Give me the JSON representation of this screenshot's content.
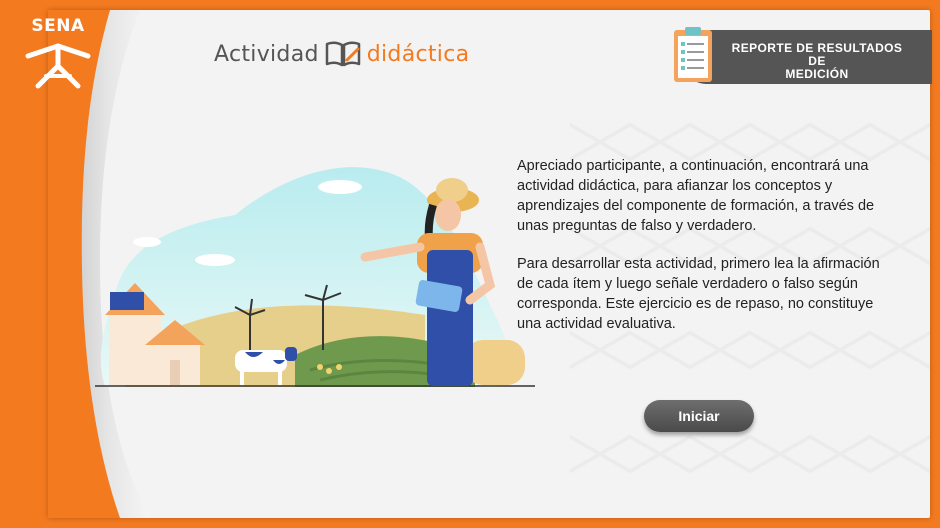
{
  "brand": {
    "logo_text": "SENA"
  },
  "header": {
    "title_part1": "Actividad",
    "title_part2": "didáctica",
    "report_label_line1": "REPORTE DE RESULTADOS DE",
    "report_label_line2": "MEDICIÓN"
  },
  "main": {
    "paragraph1": "Apreciado participante, a continuación, encontrará una actividad didáctica, para afianzar los conceptos y aprendizajes del componente de formación, a través de unas preguntas de falso y verdadero.",
    "paragraph2": "Para desarrollar esta actividad, primero lea la afirmación de cada ítem y luego señale verdadero o falso según corresponda. Este ejercicio es de repaso, no constituye una actividad evaluativa.",
    "start_button": "Iniciar"
  },
  "colors": {
    "accent": "#f47a1f",
    "dark": "#555555",
    "background": "#f3f3f3"
  }
}
